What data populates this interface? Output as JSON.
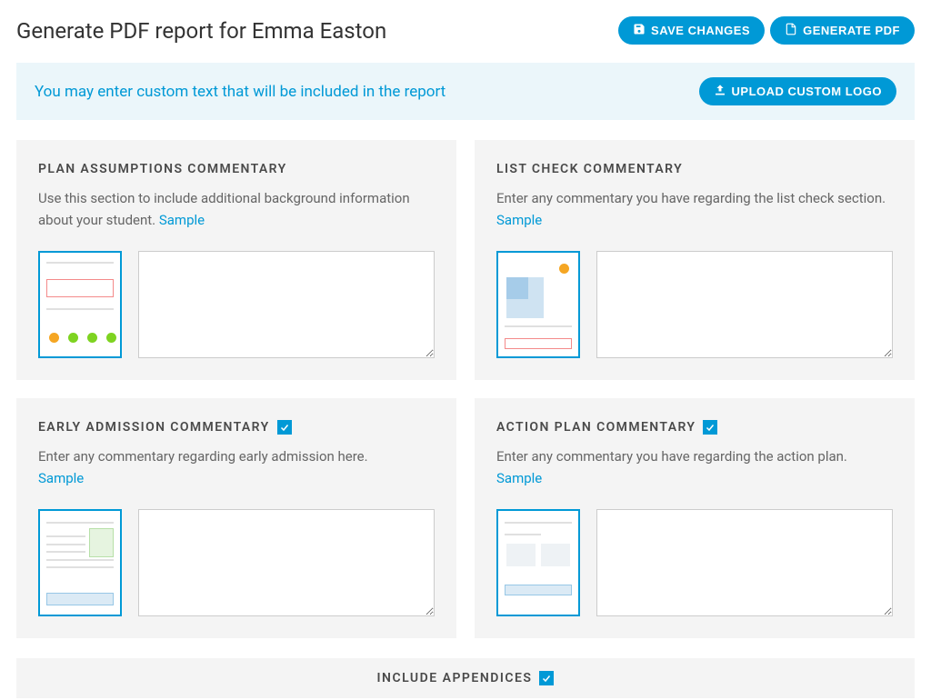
{
  "header": {
    "title": "Generate PDF report for Emma Easton",
    "save_label": "SAVE CHANGES",
    "generate_label": "GENERATE PDF"
  },
  "info_bar": {
    "text": "You may enter custom text that will be included in the report",
    "upload_label": "UPLOAD CUSTOM LOGO"
  },
  "cards": {
    "plan": {
      "title": "PLAN ASSUMPTIONS COMMENTARY",
      "desc_prefix": "Use this section to include additional background information about your student. ",
      "sample": "Sample",
      "has_checkbox": false
    },
    "list_check": {
      "title": "LIST CHECK COMMENTARY",
      "desc_prefix": "Enter any commentary you have regarding the list check section. ",
      "sample": "Sample",
      "has_checkbox": false
    },
    "early_admission": {
      "title": "EARLY ADMISSION COMMENTARY",
      "desc_prefix": "Enter any commentary regarding early admission here. ",
      "sample": "Sample",
      "has_checkbox": true,
      "checked": true
    },
    "action_plan": {
      "title": "ACTION PLAN COMMENTARY",
      "desc_prefix": "Enter any commentary you have regarding the action plan. ",
      "sample": "Sample",
      "has_checkbox": true,
      "checked": true
    }
  },
  "appendices": {
    "title": "INCLUDE APPENDICES",
    "checked": true
  }
}
